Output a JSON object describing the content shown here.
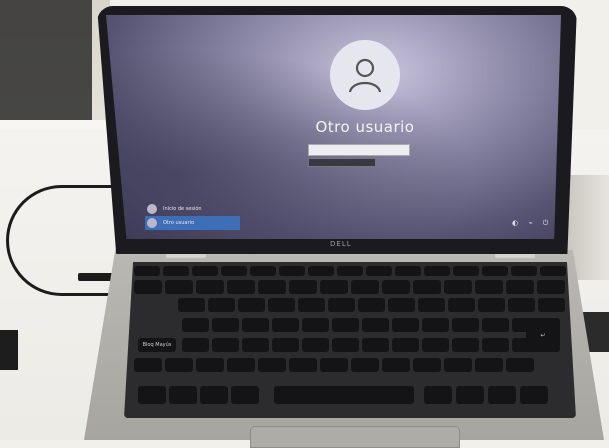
{
  "screen": {
    "username": "Otro usuario",
    "accounts": [
      {
        "label": "Inicio de sesión"
      },
      {
        "label": "Otro usuario"
      }
    ]
  },
  "laptop": {
    "brand": "DELL"
  },
  "keyboard": {
    "caps_key": "Bloq Mayús",
    "enter_key": "↵",
    "space_key": ""
  }
}
